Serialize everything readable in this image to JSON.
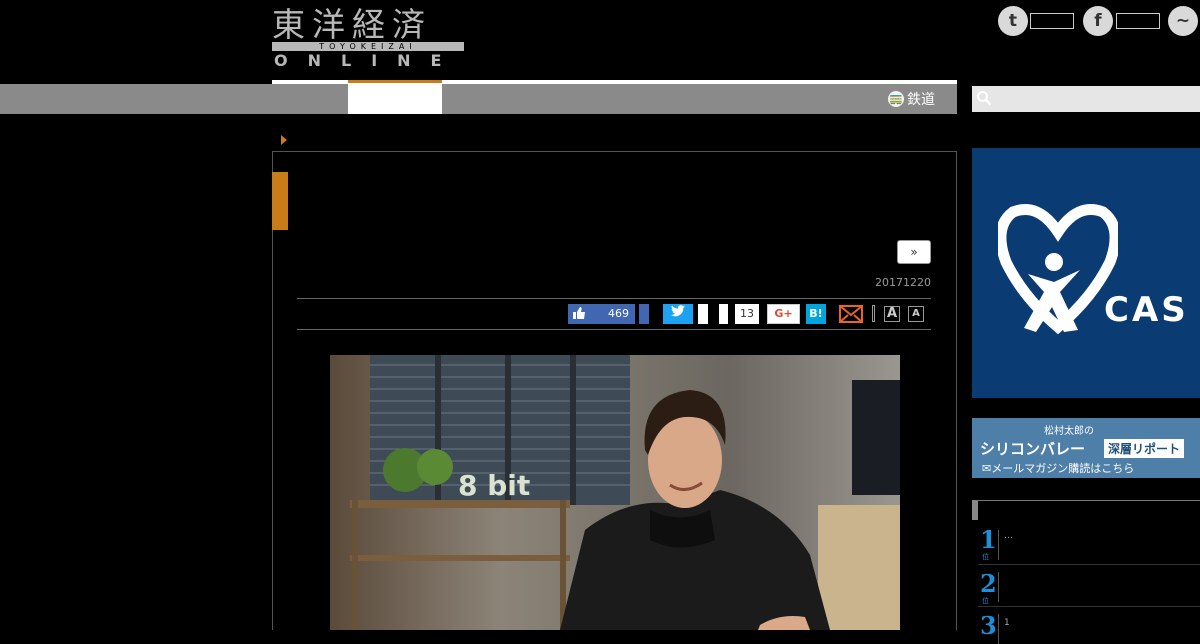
{
  "header": {
    "logo": {
      "kanji": "東洋経済",
      "band": "TOYOKEIZAI",
      "online": "ONLINE"
    },
    "social": [
      {
        "name": "twitter",
        "glyph": "t"
      },
      {
        "name": "facebook",
        "glyph": "f"
      },
      {
        "name": "messenger",
        "glyph": "~"
      }
    ]
  },
  "nav": {
    "railway_label": "鉄道",
    "search": {
      "placeholder": ""
    }
  },
  "article": {
    "next_label": "»",
    "date": "20171220",
    "share": {
      "facebook_count": "469",
      "hatena_count": "13",
      "gplus_label": "G+",
      "hatena_label": "B!",
      "font_large": "A",
      "font_small": "A"
    }
  },
  "sidebar": {
    "ad_cas_text": "CAS",
    "ad_mag": {
      "line1": "松村太郎の",
      "line2": "シリコンバレー",
      "line2b": "深層リポート",
      "line3": "✉メールマガジン購読はこちら"
    },
    "ranking": [
      {
        "rank": "1",
        "unit": "位",
        "text": "…"
      },
      {
        "rank": "2",
        "unit": "位",
        "text": ""
      },
      {
        "rank": "3",
        "unit": "位",
        "text": "1"
      }
    ]
  },
  "colors": {
    "accent": "#c87d18",
    "nav": "#8a8a8a",
    "ad_blue": "#0b3b73",
    "rank_blue": "#1b8fd7"
  }
}
